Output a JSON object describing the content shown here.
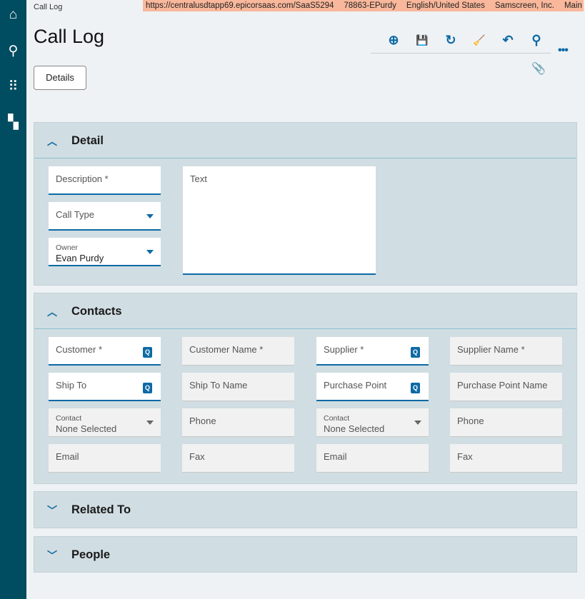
{
  "sidebar": {
    "items": [
      {
        "icon": "home-icon",
        "glyph": "⌂"
      },
      {
        "icon": "search-icon",
        "glyph": "⚲"
      },
      {
        "icon": "apps-grid-icon",
        "glyph": "⠿"
      },
      {
        "icon": "dashboard-icon",
        "glyph": "▚"
      }
    ]
  },
  "breadcrumb": "Call Log",
  "env": {
    "url": "https://centralusdtapp69.epicorsaas.com/SaaS5294",
    "user": "78863-EPurdy",
    "language": "English/United States",
    "company": "Samscreen, Inc.",
    "plant": "Main Plant"
  },
  "page_title": "Call Log",
  "toolbar": {
    "add": "⊕",
    "save": "💾",
    "refresh": "↻",
    "clear": "🧹",
    "undo": "↶",
    "search": "⚲",
    "more": "•••",
    "attach": "📎"
  },
  "details_button": "Details",
  "detail": {
    "title": "Detail",
    "description_label": "Description *",
    "call_type_label": "Call Type",
    "owner_label": "Owner",
    "owner_value": "Evan Purdy",
    "text_label": "Text"
  },
  "contacts": {
    "title": "Contacts",
    "customer": "Customer *",
    "customer_name": "Customer Name *",
    "supplier": "Supplier *",
    "supplier_name": "Supplier Name *",
    "ship_to": "Ship To",
    "ship_to_name": "Ship To Name",
    "purchase_point": "Purchase Point",
    "purchase_point_name": "Purchase Point Name",
    "contact_label": "Contact",
    "contact_value": "None Selected",
    "phone": "Phone",
    "email": "Email",
    "fax": "Fax"
  },
  "related_to": {
    "title": "Related To"
  },
  "people": {
    "title": "People"
  }
}
